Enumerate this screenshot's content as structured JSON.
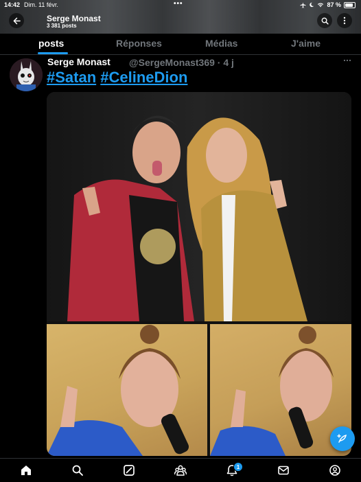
{
  "status_bar": {
    "time": "14:42",
    "date": "Dim. 11 févr.",
    "battery": "87 %"
  },
  "profile": {
    "name": "Serge Monast",
    "posts_count": "3 381 posts"
  },
  "tabs": [
    {
      "label": "posts",
      "active": true
    },
    {
      "label": "Réponses",
      "active": false
    },
    {
      "label": "Médias",
      "active": false
    },
    {
      "label": "J'aime",
      "active": false
    }
  ],
  "post": {
    "author": "Serge Monast",
    "handle_time": "@SergeMonast369 · 4 j",
    "hashtags": [
      "#Satan",
      "#CelineDion"
    ]
  },
  "nav": {
    "icons": [
      "home-icon",
      "search-icon",
      "grok-icon",
      "communities-icon",
      "notifications-icon",
      "messages-icon",
      "premium-icon"
    ],
    "notification_count": "1"
  },
  "colors": {
    "accent": "#1d9bf0",
    "background": "#000000",
    "text": "#e7e9ea",
    "muted": "#71767b"
  }
}
